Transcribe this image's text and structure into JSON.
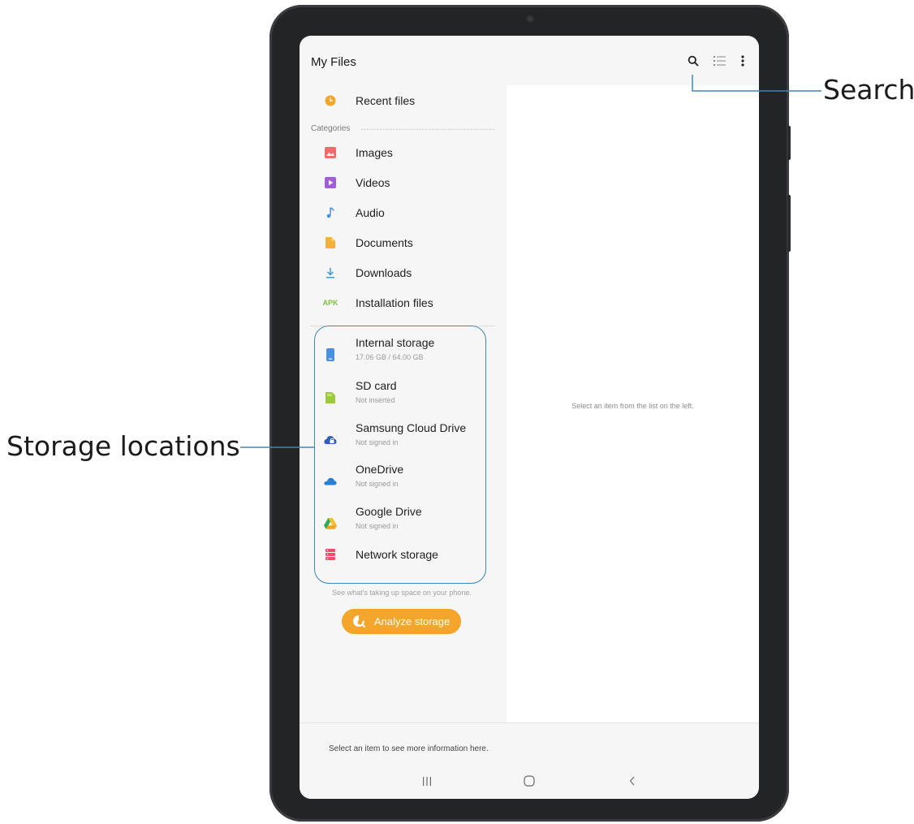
{
  "callouts": {
    "search": "Search",
    "storage": "Storage locations"
  },
  "header": {
    "title": "My Files",
    "icons": [
      "search-icon",
      "list-view-icon",
      "more-options-icon"
    ]
  },
  "recent": {
    "label": "Recent files"
  },
  "categories": {
    "heading": "Categories",
    "items": [
      {
        "label": "Images",
        "icon": "images-icon"
      },
      {
        "label": "Videos",
        "icon": "videos-icon"
      },
      {
        "label": "Audio",
        "icon": "audio-icon"
      },
      {
        "label": "Documents",
        "icon": "documents-icon"
      },
      {
        "label": "Downloads",
        "icon": "downloads-icon"
      },
      {
        "label": "Installation files",
        "icon": "apk-icon",
        "icon_text": "APK"
      }
    ]
  },
  "storage": [
    {
      "label": "Internal storage",
      "sub": "17.06 GB / 64.00 GB",
      "icon": "phone-storage-icon"
    },
    {
      "label": "SD card",
      "sub": "Not inserted",
      "icon": "sd-card-icon"
    },
    {
      "label": "Samsung Cloud Drive",
      "sub": "Not signed in",
      "icon": "samsung-cloud-icon"
    },
    {
      "label": "OneDrive",
      "sub": "Not signed in",
      "icon": "onedrive-icon"
    },
    {
      "label": "Google Drive",
      "sub": "Not signed in",
      "icon": "google-drive-icon"
    },
    {
      "label": "Network storage",
      "sub": "",
      "icon": "network-storage-icon"
    }
  ],
  "analyze": {
    "hint": "See what's taking up space on your phone.",
    "button": "Analyze storage"
  },
  "right_panel": {
    "message": "Select an item from the list on the left."
  },
  "bottom": {
    "info": "Select an item to see more information here."
  },
  "colors": {
    "accent_orange": "#f3a52c",
    "callout_line": "#3e87b8",
    "icon_blue": "#4a8fe0",
    "icon_green": "#7dc142"
  }
}
